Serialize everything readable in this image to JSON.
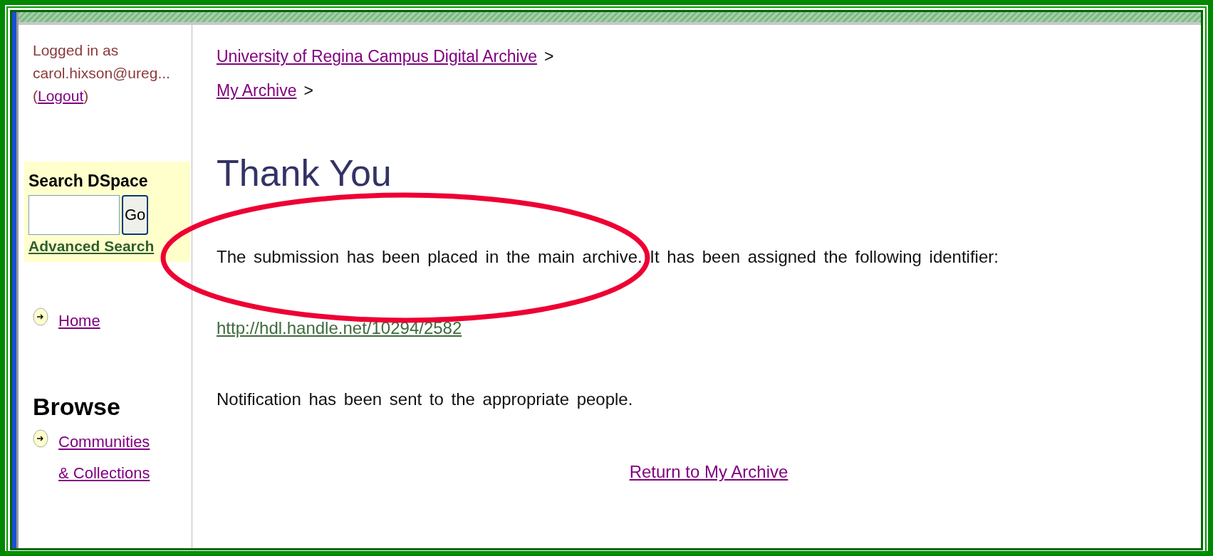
{
  "user": {
    "label": "Logged in as",
    "email": "carol.hixson@ureg...",
    "logout_prefix": "(",
    "logout": "Logout",
    "logout_suffix": ")"
  },
  "search": {
    "title": "Search DSpace",
    "button": "Go",
    "advanced": "Advanced Search"
  },
  "nav": [
    {
      "label": "Home"
    }
  ],
  "browse": {
    "title": "Browse",
    "items": [
      {
        "label": "Communities & Collections"
      }
    ]
  },
  "breadcrumb": [
    {
      "label": "University of Regina Campus Digital Archive",
      "separator": ">"
    },
    {
      "label": "My Archive",
      "separator": ">"
    }
  ],
  "heading": "Thank You",
  "message": "The submission has been placed in the main archive. It has been assigned the following identifier:",
  "handle_link": "http://hdl.handle.net/10294/2582",
  "notification": "Notification has been sent to the appropriate people.",
  "return_link": "Return to My Archive"
}
